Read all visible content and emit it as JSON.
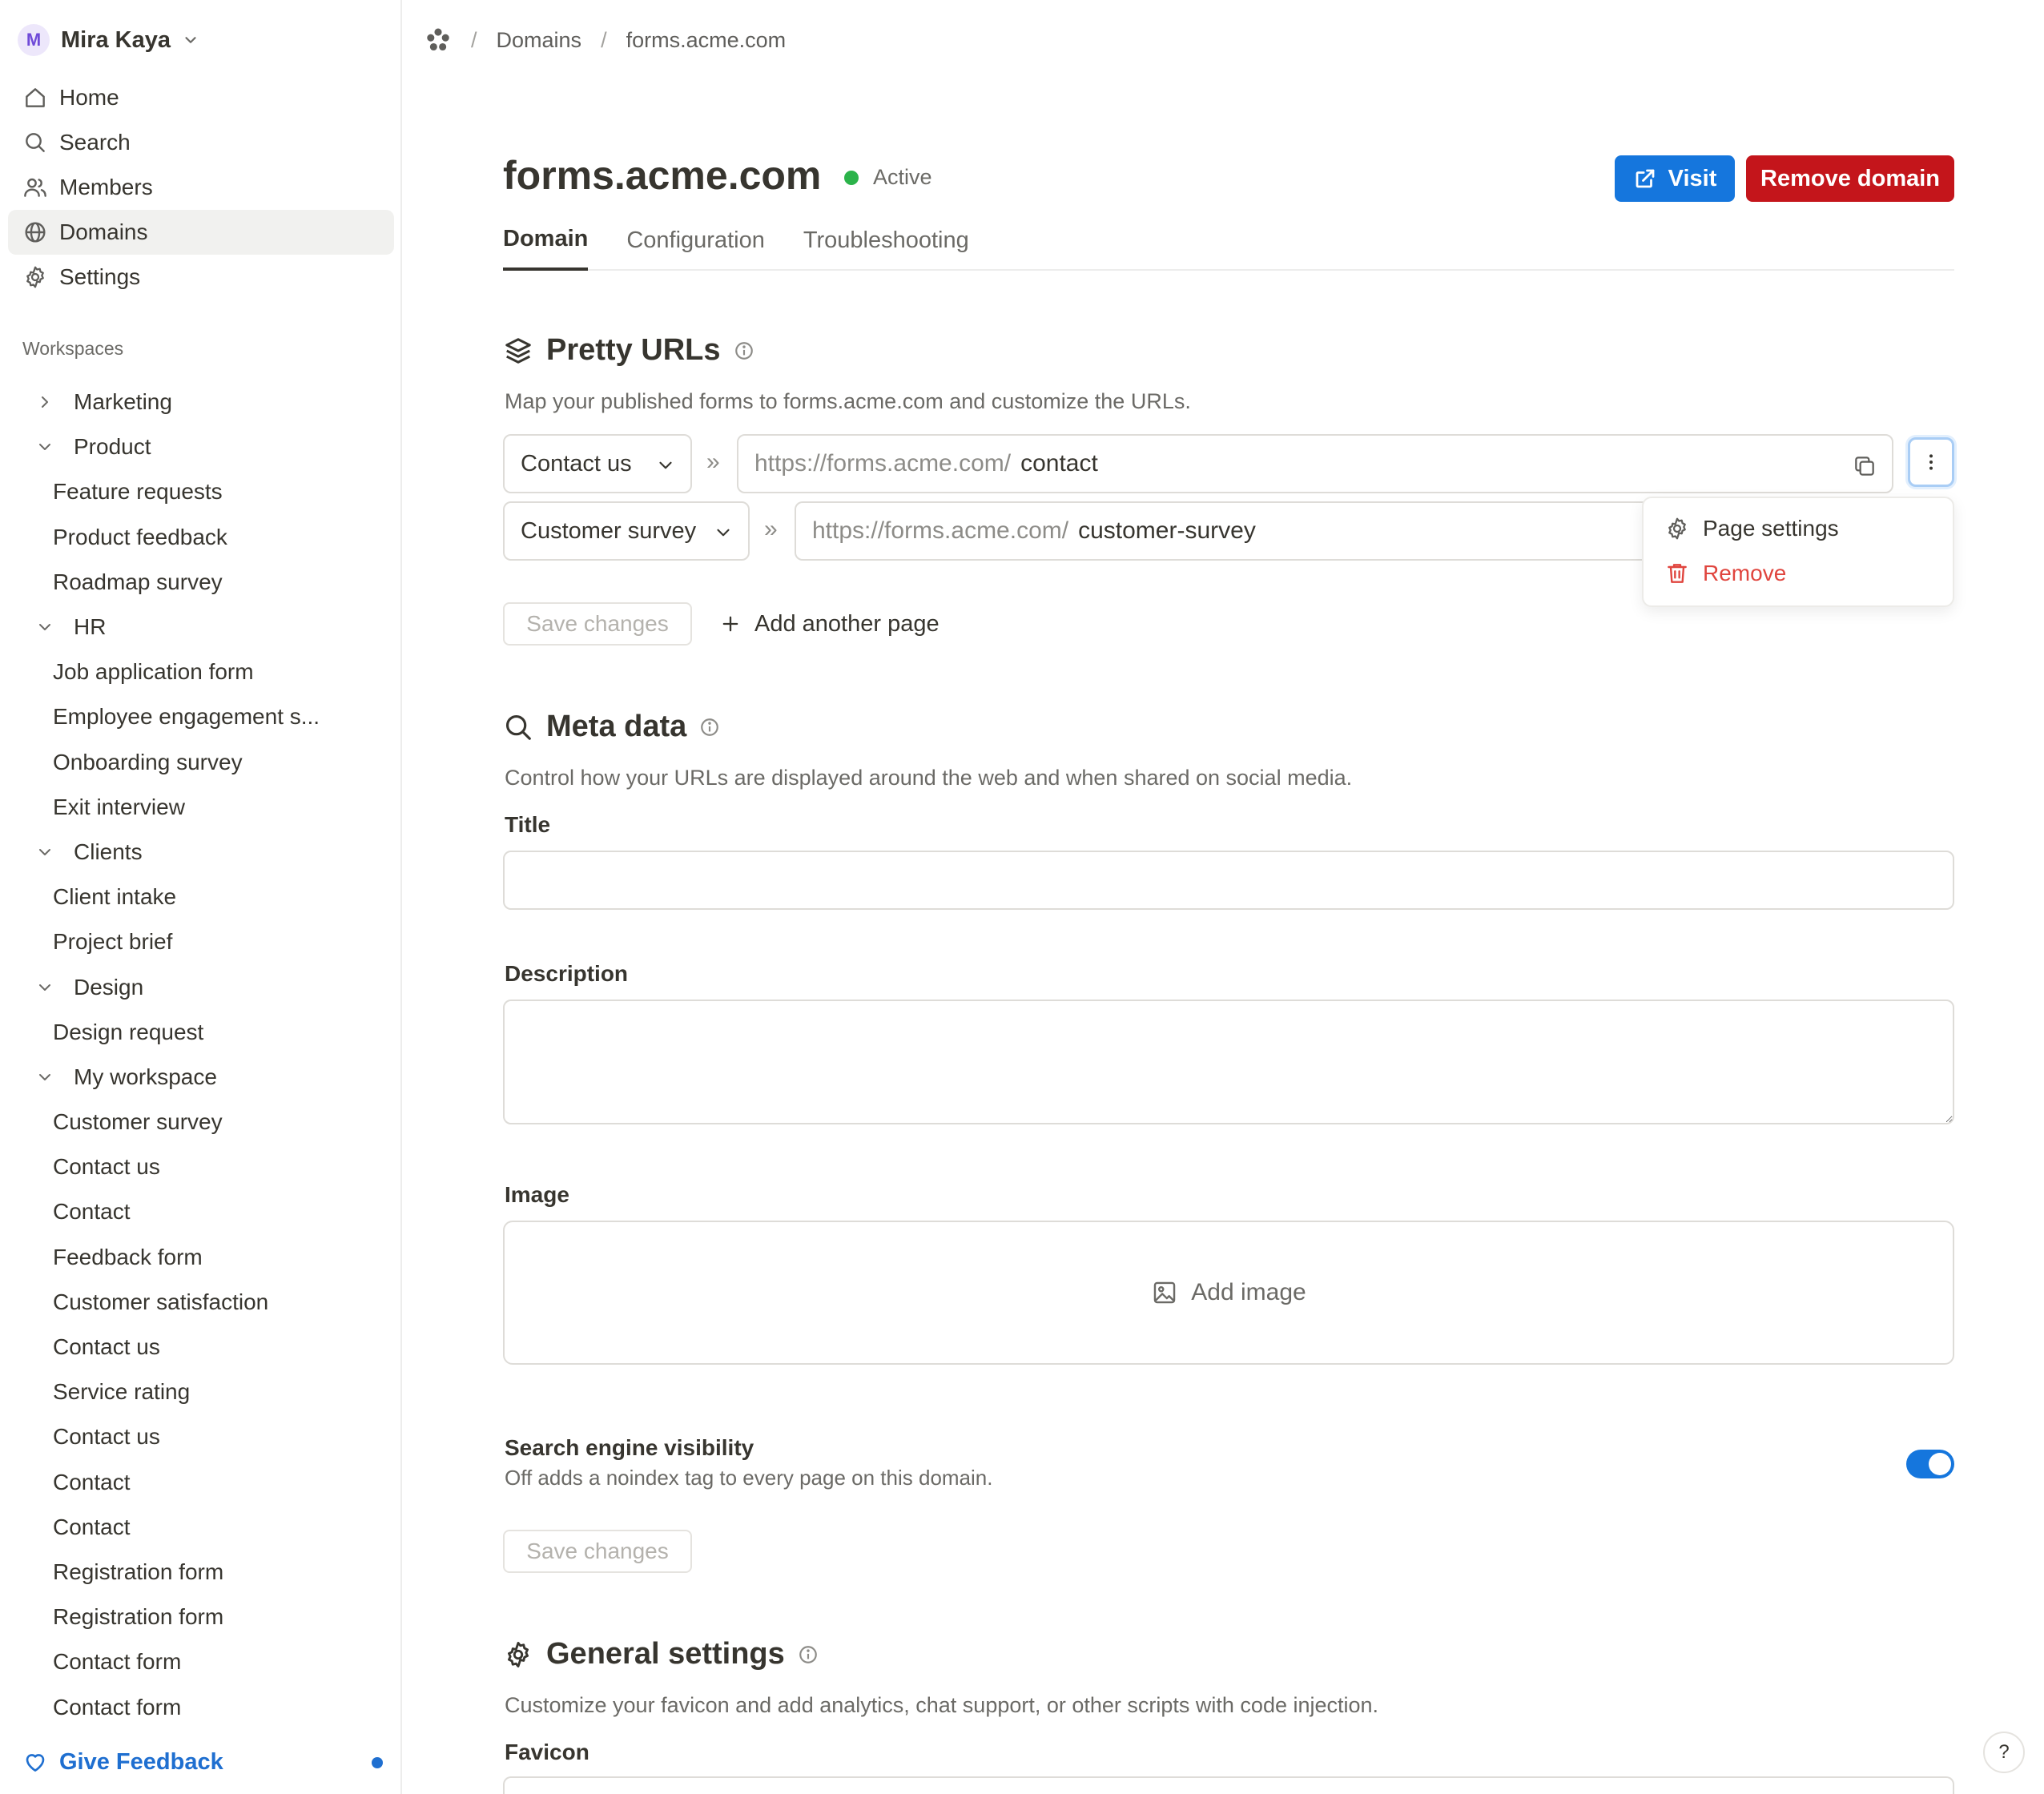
{
  "user": {
    "initial": "M",
    "name": "Mira Kaya"
  },
  "nav": [
    {
      "label": "Home",
      "icon": "home-icon"
    },
    {
      "label": "Search",
      "icon": "search-icon"
    },
    {
      "label": "Members",
      "icon": "members-icon"
    },
    {
      "label": "Domains",
      "icon": "globe-icon",
      "active": true
    },
    {
      "label": "Settings",
      "icon": "gear-icon"
    }
  ],
  "workspaces": {
    "heading": "Workspaces",
    "items": [
      {
        "label": "Marketing",
        "type": "group",
        "expanded": false
      },
      {
        "label": "Product",
        "type": "group",
        "expanded": true
      },
      {
        "label": "Feature requests",
        "type": "leaf"
      },
      {
        "label": "Product feedback",
        "type": "leaf"
      },
      {
        "label": "Roadmap survey",
        "type": "leaf"
      },
      {
        "label": "HR",
        "type": "group",
        "expanded": true
      },
      {
        "label": "Job application form",
        "type": "leaf"
      },
      {
        "label": "Employee engagement s...",
        "type": "leaf"
      },
      {
        "label": "Onboarding survey",
        "type": "leaf"
      },
      {
        "label": "Exit interview",
        "type": "leaf"
      },
      {
        "label": "Clients",
        "type": "group",
        "expanded": true
      },
      {
        "label": "Client intake",
        "type": "leaf"
      },
      {
        "label": "Project brief",
        "type": "leaf"
      },
      {
        "label": "Design",
        "type": "group",
        "expanded": true
      },
      {
        "label": "Design request",
        "type": "leaf"
      },
      {
        "label": "My workspace",
        "type": "group",
        "expanded": true
      },
      {
        "label": "Customer survey",
        "type": "leaf"
      },
      {
        "label": "Contact us",
        "type": "leaf"
      },
      {
        "label": "Contact",
        "type": "leaf"
      },
      {
        "label": "Feedback form",
        "type": "leaf"
      },
      {
        "label": "Customer satisfaction",
        "type": "leaf"
      },
      {
        "label": "Contact us",
        "type": "leaf"
      },
      {
        "label": "Service rating",
        "type": "leaf"
      },
      {
        "label": "Contact us",
        "type": "leaf"
      },
      {
        "label": "Contact",
        "type": "leaf"
      },
      {
        "label": "Contact",
        "type": "leaf"
      },
      {
        "label": "Registration form",
        "type": "leaf"
      },
      {
        "label": "Registration form",
        "type": "leaf"
      },
      {
        "label": "Contact form",
        "type": "leaf"
      },
      {
        "label": "Contact form",
        "type": "leaf"
      }
    ]
  },
  "feedback": {
    "label": "Give Feedback"
  },
  "breadcrumb": {
    "items": [
      "Domains",
      "forms.acme.com"
    ],
    "separator": "/"
  },
  "header": {
    "title": "forms.acme.com",
    "status": "Active",
    "visit_label": "Visit",
    "remove_label": "Remove domain"
  },
  "tabs": [
    {
      "label": "Domain",
      "active": true
    },
    {
      "label": "Configuration"
    },
    {
      "label": "Troubleshooting"
    }
  ],
  "pretty_urls": {
    "title": "Pretty URLs",
    "description": "Map your published forms to forms.acme.com and customize the URLs.",
    "separator": "»",
    "rows": [
      {
        "page": "Contact us",
        "prefix": "https://forms.acme.com/",
        "slug": "contact"
      },
      {
        "page": "Customer survey",
        "prefix": "https://forms.acme.com/",
        "slug": "customer-survey"
      }
    ],
    "menu": {
      "settings_label": "Page settings",
      "remove_label": "Remove"
    },
    "save_label": "Save changes",
    "add_page_label": "Add another page"
  },
  "meta": {
    "title": "Meta data",
    "description": "Control how your URLs are displayed around the web and when shared on social media.",
    "title_label": "Title",
    "title_value": "",
    "description_label": "Description",
    "description_value": "",
    "image_label": "Image",
    "add_image_label": "Add image",
    "seo_title": "Search engine visibility",
    "seo_description": "Off adds a noindex tag to every page on this domain.",
    "seo_enabled": true,
    "save_label": "Save changes"
  },
  "general": {
    "title": "General settings",
    "description": "Customize your favicon and add analytics, chat support, or other scripts with code injection.",
    "favicon_label": "Favicon"
  },
  "help": {
    "label": "?"
  },
  "colors": {
    "accent": "#1576dd",
    "danger": "#c4151b",
    "status_active": "#2bb34a",
    "remove_text": "#e0453e"
  }
}
